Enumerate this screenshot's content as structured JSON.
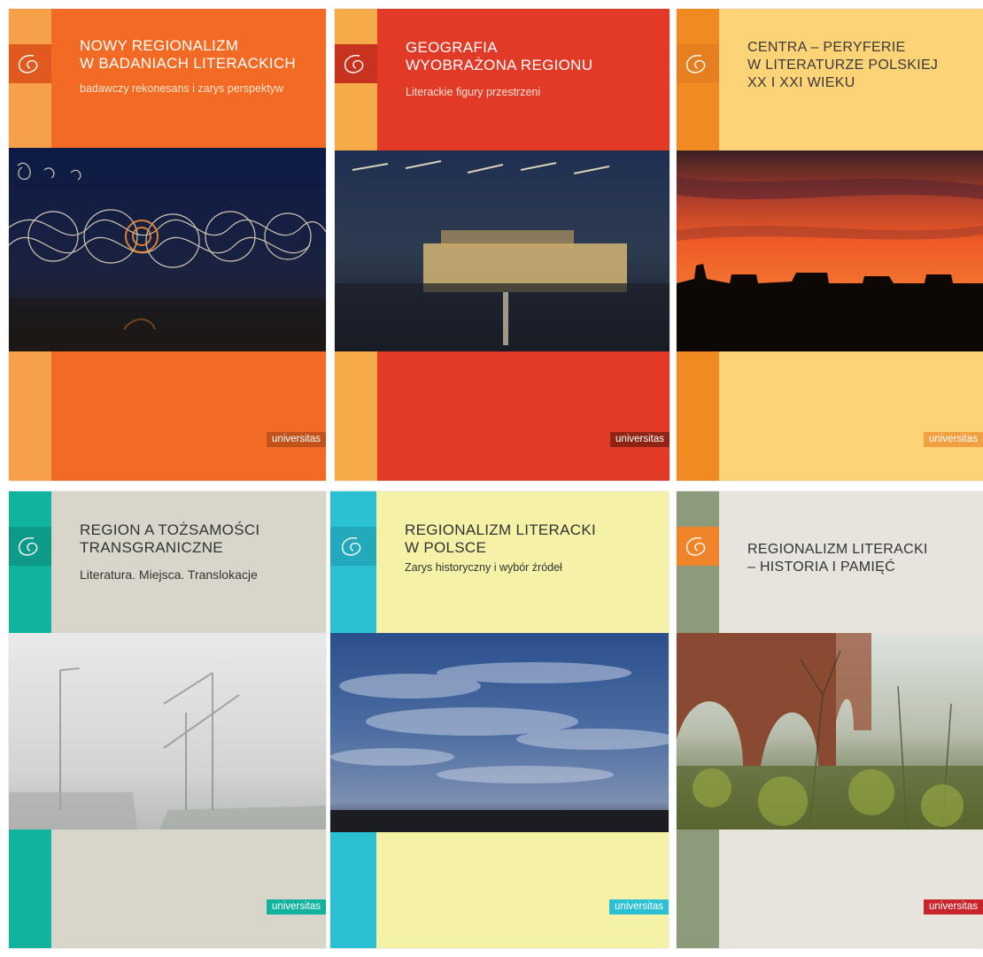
{
  "covers": [
    {
      "title": "NOWY REGIONALIZM\nW BADANIACH LITERACKICH",
      "subtitle": "badawczy rekonesans i zarys perspektyw",
      "publisher": "universitas",
      "colors": {
        "band": "#f6a04a",
        "main": "#f26a24",
        "logo": "#e05a20",
        "title": "#ffffff",
        "subtitle": "#ffe6cf",
        "publisher": "#c0521a"
      }
    },
    {
      "title": "GEOGRAFIA\nWYOBRAŻONA REGIONU",
      "subtitle": "Literackie figury przestrzeni",
      "publisher": "universitas",
      "colors": {
        "band": "#f6aa48",
        "main": "#e13a26",
        "logo": "#c8331f",
        "title": "#ffffff",
        "subtitle": "#ffe3d6",
        "publisher": "#8f2414"
      }
    },
    {
      "title": "CENTRA – PERYFERIE\nW LITERATURZE POLSKIEJ\nXX I XXI WIEKU",
      "subtitle": "",
      "publisher": "universitas",
      "colors": {
        "band": "#f28a22",
        "main": "#fdd377",
        "logo": "#e57f1f",
        "title": "#3a3a3a",
        "subtitle": "#3a3a3a",
        "publisher": "#f0a040"
      }
    },
    {
      "title": "REGION A TOŻSAMOŚCI\nTRANSGRANICZNE",
      "subtitle": "Literatura. Miejsca. Translokacje",
      "publisher": "universitas",
      "colors": {
        "band": "#11b29e",
        "main": "#d8d6cb",
        "logo": "#0d9a88",
        "title": "#333333",
        "subtitle": "#333333",
        "publisher": "#11b29e"
      }
    },
    {
      "title": "REGIONALIZM LITERACKI\nW POLSCE",
      "subtitle": "Zarys historyczny i wybór źródeł",
      "publisher": "universitas",
      "colors": {
        "band": "#2bc0d4",
        "main": "#f5f1a6",
        "logo": "#22a9bb",
        "title": "#333333",
        "subtitle": "#333333",
        "publisher": "#2bc0d4"
      }
    },
    {
      "title": "REGIONALIZM LITERACKI\n– HISTORIA I PAMIĘĆ",
      "subtitle": "",
      "publisher": "universitas",
      "colors": {
        "band": "#8c9c7a",
        "main": "#e7e4dd",
        "logo": "#f0842a",
        "title": "#333333",
        "subtitle": "#333333",
        "publisher": "#c8252b"
      }
    }
  ]
}
